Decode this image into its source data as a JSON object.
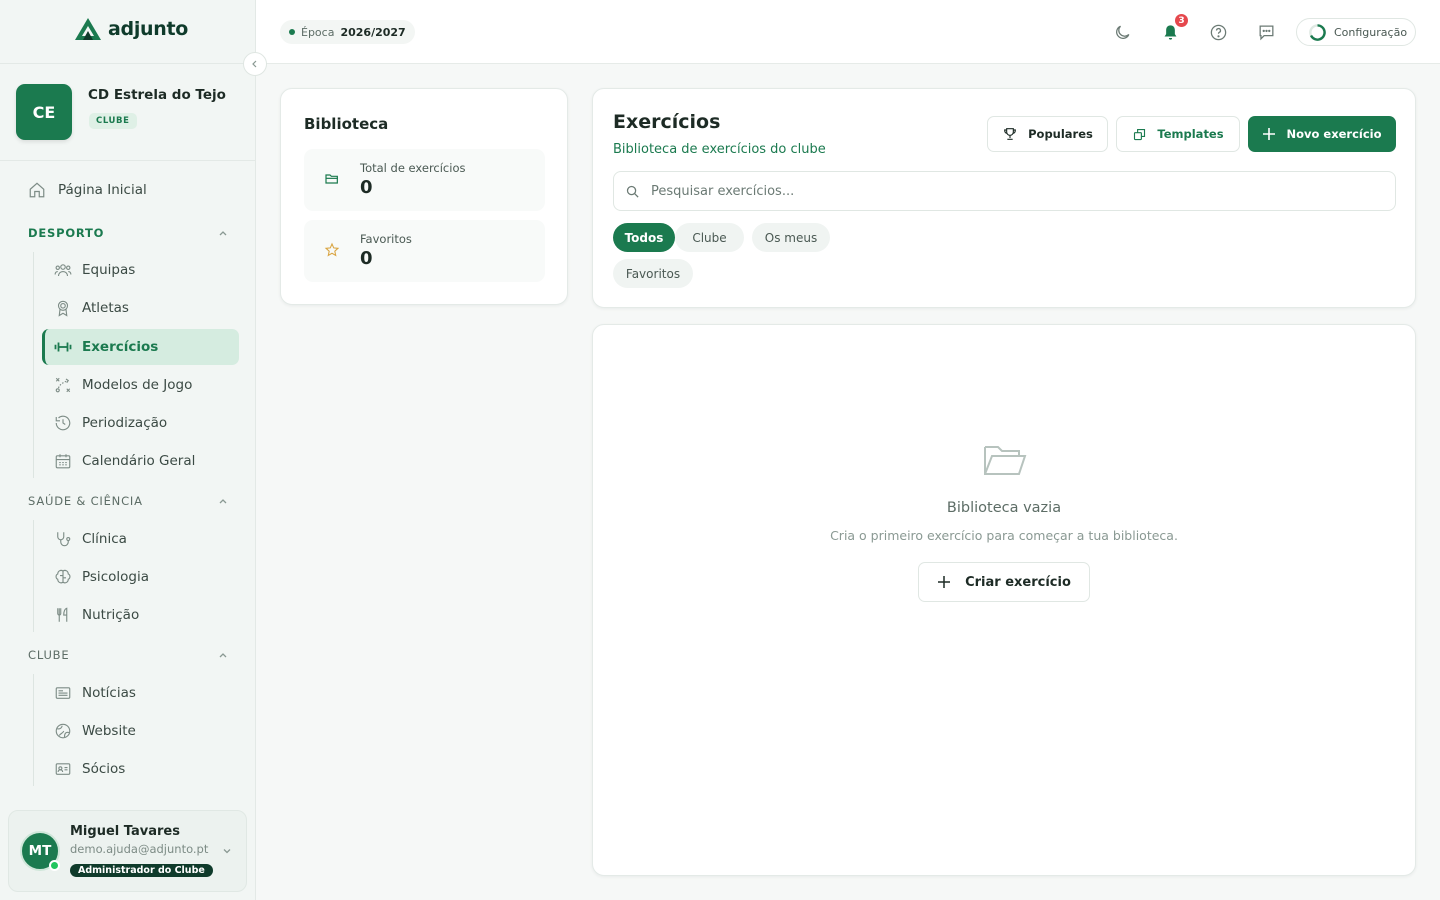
{
  "brand": {
    "name": "adjunto"
  },
  "club": {
    "initials": "CE",
    "name": "CD Estrela do Tejo",
    "badge": "CLUBE"
  },
  "sidebar": {
    "home": "Página Inicial",
    "sections": [
      {
        "title": "DESPORTO",
        "items": [
          "Equipas",
          "Atletas",
          "Exercícios",
          "Modelos de Jogo",
          "Periodização",
          "Calendário Geral"
        ]
      },
      {
        "title": "SAÚDE & CIÊNCIA",
        "items": [
          "Clínica",
          "Psicologia",
          "Nutrição"
        ]
      },
      {
        "title": "CLUBE",
        "items": [
          "Notícias",
          "Website",
          "Sócios"
        ]
      }
    ],
    "active_item": "Exercícios"
  },
  "user": {
    "initials": "MT",
    "name": "Miguel Tavares",
    "email": "demo.ajuda@adjunto.pt",
    "role": "Administrador do Clube"
  },
  "topbar": {
    "season_label": "Época",
    "season_value": "2026/2027",
    "notifications_count": "3",
    "config_label": "Configuração",
    "icons": [
      "moon-icon",
      "bell-icon",
      "help-icon",
      "chat-icon"
    ]
  },
  "library": {
    "title": "Biblioteca",
    "stats": [
      {
        "label": "Total de exercícios",
        "value": "0",
        "icon": "folder-icon"
      },
      {
        "label": "Favoritos",
        "value": "0",
        "icon": "star-icon"
      }
    ]
  },
  "exercises": {
    "title": "Exercícios",
    "subtitle": "Biblioteca de exercícios do clube",
    "buttons": {
      "popular": "Populares",
      "templates": "Templates",
      "new": "Novo exercício"
    },
    "search_placeholder": "Pesquisar exercícios...",
    "filters": [
      "Todos",
      "Clube",
      "Os meus",
      "Favoritos"
    ],
    "active_filter": "Todos"
  },
  "empty_state": {
    "title": "Biblioteca vazia",
    "subtitle": "Cria o primeiro exercício para começar a tua biblioteca.",
    "button": "Criar exercício"
  },
  "colors": {
    "primary": "#1b7a4f",
    "dark": "#0f3b2b",
    "badge_red": "#e5484d",
    "online": "#22c55e"
  }
}
